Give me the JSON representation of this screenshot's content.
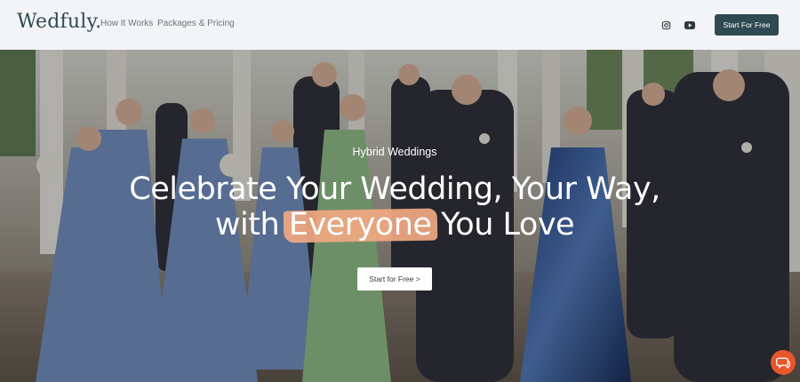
{
  "header": {
    "logo": "Wedfuly.",
    "nav": [
      {
        "label": "How It Works"
      },
      {
        "label": "Packages & Pricing"
      }
    ],
    "social": [
      {
        "icon": "instagram-icon"
      },
      {
        "icon": "youtube-icon"
      }
    ],
    "cta_label": "Start For Free"
  },
  "hero": {
    "eyebrow": "Hybrid Weddings",
    "headline_line1": "Celebrate Your Wedding, Your Way,",
    "headline_line2_before": "with",
    "headline_highlight": "Everyone",
    "headline_line2_after": "You Love",
    "cta_label": "Start for Free >"
  },
  "chat_widget": {
    "icon": "chat-bubble-icon"
  },
  "colors": {
    "brand": "#2f4a52",
    "highlight": "#f0a882",
    "chat": "#e8572a",
    "header_bg": "#f3f4f7"
  }
}
